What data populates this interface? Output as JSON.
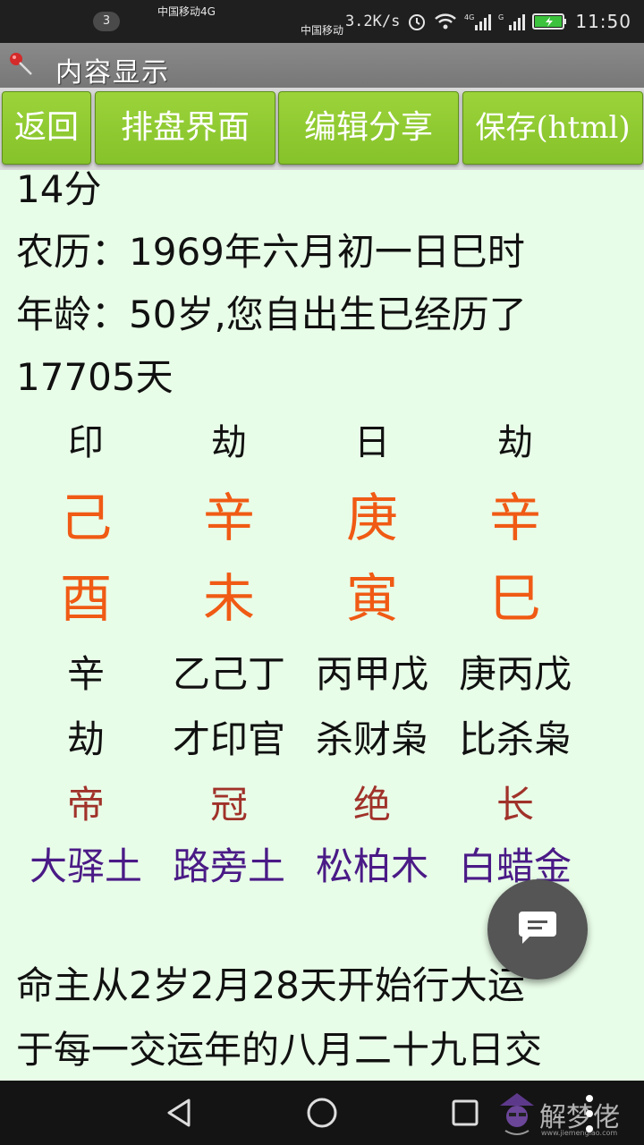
{
  "statusbar": {
    "carrier1": "中国移动4G",
    "carrier2": "中国移动",
    "notification_count": "3",
    "net_speed": "3.2K/s",
    "time": "11:50",
    "icons": [
      "alarm-icon",
      "wifi-icon",
      "signal-4g-icon",
      "signal-g-icon",
      "battery-charging-icon"
    ]
  },
  "titlebar": {
    "title": "内容显示",
    "icon": "pin-icon"
  },
  "toolbar": {
    "back_label": "返回",
    "chart_label": "排盘界面",
    "edit_share_label": "编辑分享",
    "save_label": "保存(html)"
  },
  "content": {
    "line0": "14分",
    "lunar": "农历：1969年六月初一日巳时",
    "age": "年龄：50岁,您自出生已经历了",
    "days": "17705天",
    "pillars": [
      {
        "god": "印",
        "stem": "己",
        "branch": "酉",
        "hidden": "辛",
        "hidden_gods": "劫",
        "stage": "帝",
        "nayin": "大驿土"
      },
      {
        "god": "劫",
        "stem": "辛",
        "branch": "未",
        "hidden": "乙己丁",
        "hidden_gods": "才印官",
        "stage": "冠",
        "nayin": "路旁土"
      },
      {
        "god": "日",
        "stem": "庚",
        "branch": "寅",
        "hidden": "丙甲戊",
        "hidden_gods": "杀财枭",
        "stage": "绝",
        "nayin": "松柏木"
      },
      {
        "god": "劫",
        "stem": "辛",
        "branch": "巳",
        "hidden": "庚丙戊",
        "hidden_gods": "比杀枭",
        "stage": "长",
        "nayin": "白蜡金"
      }
    ],
    "dayun_line1": "命主从2岁2月28天开始行大运",
    "dayun_line2": "于每一交运年的八月二十九日交"
  },
  "fab": {
    "icon": "chat-bubble-icon"
  },
  "navbar": {
    "icons": [
      "back-triangle-icon",
      "home-circle-icon",
      "recents-square-icon"
    ],
    "watermark_text": "解梦佬",
    "watermark_url": "www.jiemenglao.com"
  },
  "colors": {
    "background": "#e8fde8",
    "button_green": "#8ec832",
    "stem_branch_orange": "#f05a14",
    "stage_red": "#a0322a",
    "nayin_purple": "#4a1a86",
    "statusbar": "#1f1f1f",
    "titlebar": "#808080"
  }
}
